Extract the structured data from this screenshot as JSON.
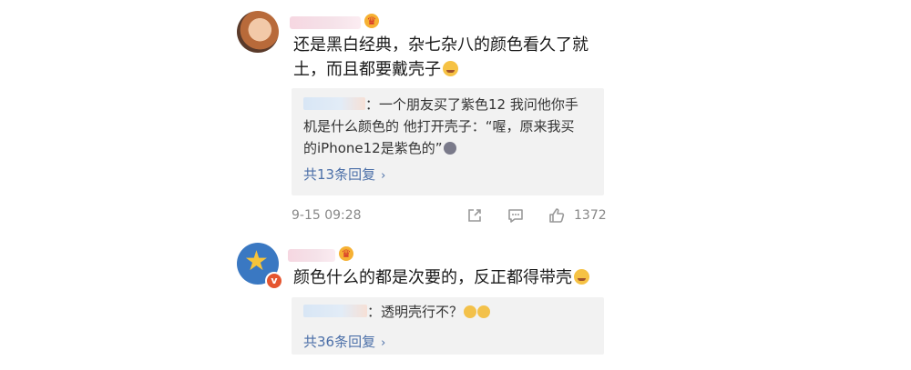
{
  "comments": [
    {
      "text_line1": "还是黑白经典，杂七杂八的颜色看久了就",
      "text_line2": "土，而且都要戴壳子",
      "emoji": "laughing-tears-emoji",
      "reply": {
        "line1": "：一个朋友买了紫色12 我问他你手",
        "line2": "机是什么颜色的 他打开壳子：“喔，原来我买",
        "line3": "的iPhone12是紫色的”",
        "more_label": "共13条回复"
      },
      "timestamp": "9-15 09:28",
      "like_count": "1372"
    },
    {
      "text": "颜色什么的都是次要的，反正都得带壳",
      "emoji": "grinning-cat-emoji",
      "reply": {
        "line1": "：透明壳行不？",
        "more_label": "共36条回复"
      }
    }
  ],
  "icons": {
    "share": "share-icon",
    "comment": "comment-icon",
    "like": "thumbs-up-icon",
    "more_chevron": "chevron-right-icon",
    "user_badge": "crown-badge-icon",
    "verified": "verified-badge-icon"
  },
  "colors": {
    "link": "#4b6fa8",
    "reply_bg": "#f2f2f2",
    "meta_text": "#888888"
  }
}
